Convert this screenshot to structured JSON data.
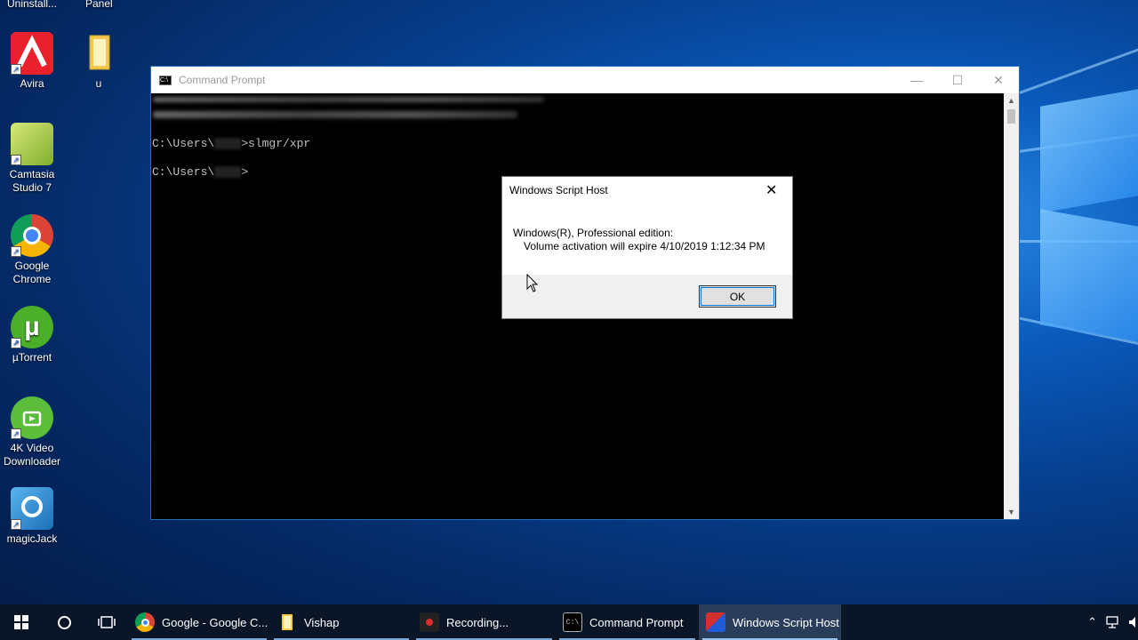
{
  "desktop": {
    "top_labels": [
      "Uninstall...",
      "Panel"
    ],
    "icons": [
      {
        "label": "Avira",
        "icon": "avira-icon",
        "color": "#e8212d"
      },
      {
        "label": "u",
        "icon": "folder-icon",
        "color": "#f2c94c"
      },
      {
        "label": "Camtasia Studio 7",
        "icon": "camtasia-icon",
        "color": "#9bc53d"
      },
      {
        "label": "Google Chrome",
        "icon": "chrome-icon",
        "color": "#4285f4"
      },
      {
        "label": "µTorrent",
        "icon": "utorrent-icon",
        "color": "#4caf2a"
      },
      {
        "label": "4K Video Downloader",
        "icon": "4k-video-downloader-icon",
        "color": "#5cbd3a"
      },
      {
        "label": "magicJack",
        "icon": "magicjack-icon",
        "color": "#2c8fd6"
      }
    ]
  },
  "cmd_window": {
    "title": "Command Prompt",
    "lines": [
      {
        "prefix": "C:\\Users\\",
        "suffix": ">slmgr/xpr"
      },
      {
        "prefix": "C:\\Users\\",
        "suffix": ">"
      }
    ]
  },
  "dialog": {
    "title": "Windows Script Host",
    "line1": "Windows(R), Professional edition:",
    "line2": "Volume activation will expire 4/10/2019 1:12:34 PM",
    "ok_label": "OK"
  },
  "taskbar": {
    "items": [
      {
        "label": "Google - Google C...",
        "icon": "chrome-icon",
        "active": false
      },
      {
        "label": "Vishap",
        "icon": "folder-icon",
        "active": false
      },
      {
        "label": "Recording...",
        "icon": "recorder-icon",
        "active": false
      },
      {
        "label": "Command Prompt",
        "icon": "cmd-icon",
        "active": false
      },
      {
        "label": "Windows Script Host",
        "icon": "script-host-icon",
        "active": true
      }
    ]
  },
  "colors": {
    "accent": "#0078d7",
    "taskbar": "#0a1528",
    "console_bg": "#000000",
    "console_text": "#c0c0c0"
  }
}
